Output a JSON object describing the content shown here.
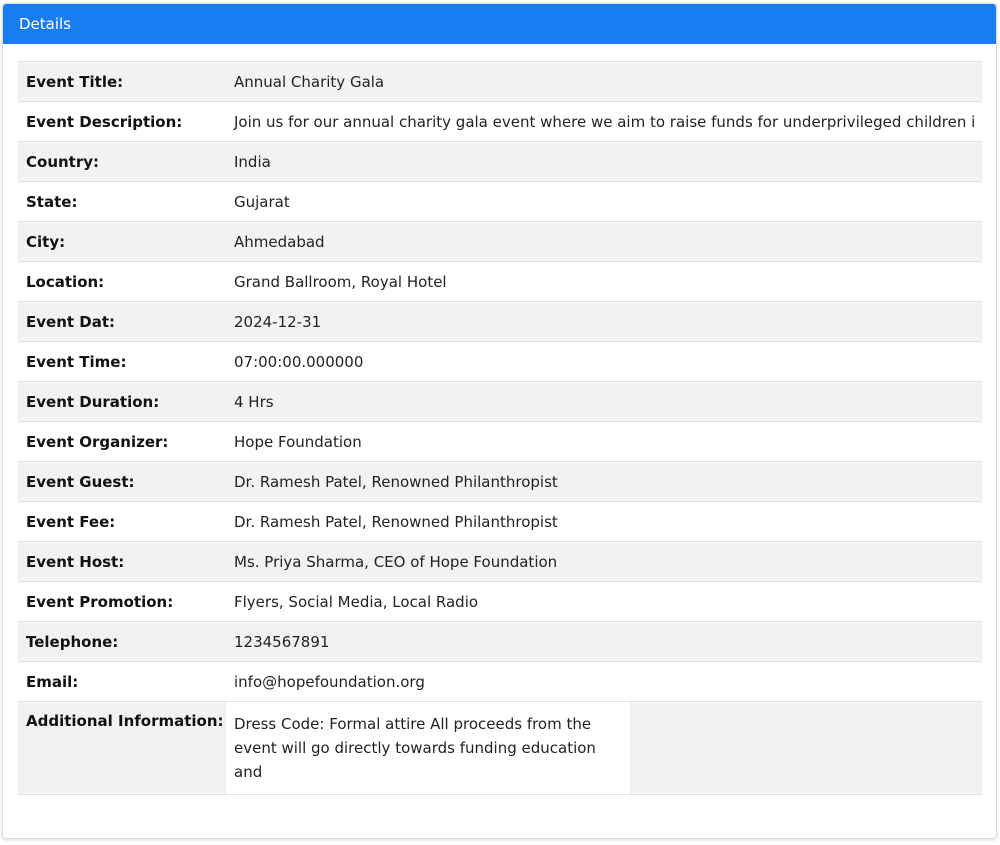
{
  "card": {
    "header": "Details"
  },
  "rows": [
    {
      "label": "Event Title:",
      "value": "Annual Charity Gala"
    },
    {
      "label": "Event Description:",
      "value": "Join us for our annual charity gala event where we aim to raise funds for underprivileged children i"
    },
    {
      "label": "Country:",
      "value": "India"
    },
    {
      "label": "State:",
      "value": "Gujarat"
    },
    {
      "label": "City:",
      "value": "Ahmedabad"
    },
    {
      "label": "Location:",
      "value": "Grand Ballroom, Royal Hotel"
    },
    {
      "label": "Event Dat:",
      "value": "2024-12-31"
    },
    {
      "label": "Event Time:",
      "value": "07:00:00.000000"
    },
    {
      "label": "Event Duration:",
      "value": "4 Hrs"
    },
    {
      "label": "Event Organizer:",
      "value": "Hope Foundation"
    },
    {
      "label": "Event Guest:",
      "value": "Dr. Ramesh Patel, Renowned Philanthropist"
    },
    {
      "label": "Event Fee:",
      "value": "Dr. Ramesh Patel, Renowned Philanthropist"
    },
    {
      "label": "Event Host:",
      "value": "Ms. Priya Sharma, CEO of Hope Foundation"
    },
    {
      "label": "Event Promotion:",
      "value": "Flyers, Social Media, Local Radio"
    },
    {
      "label": "Telephone:",
      "value": "1234567891"
    },
    {
      "label": "Email:",
      "value": "info@hopefoundation.org"
    },
    {
      "label": "Additional Information:",
      "value": "Dress Code: Formal attire All proceeds from the event will go directly towards funding education and"
    }
  ],
  "colors": {
    "header_bg": "#1a7cf1",
    "stripe_bg": "#f2f2f2"
  }
}
